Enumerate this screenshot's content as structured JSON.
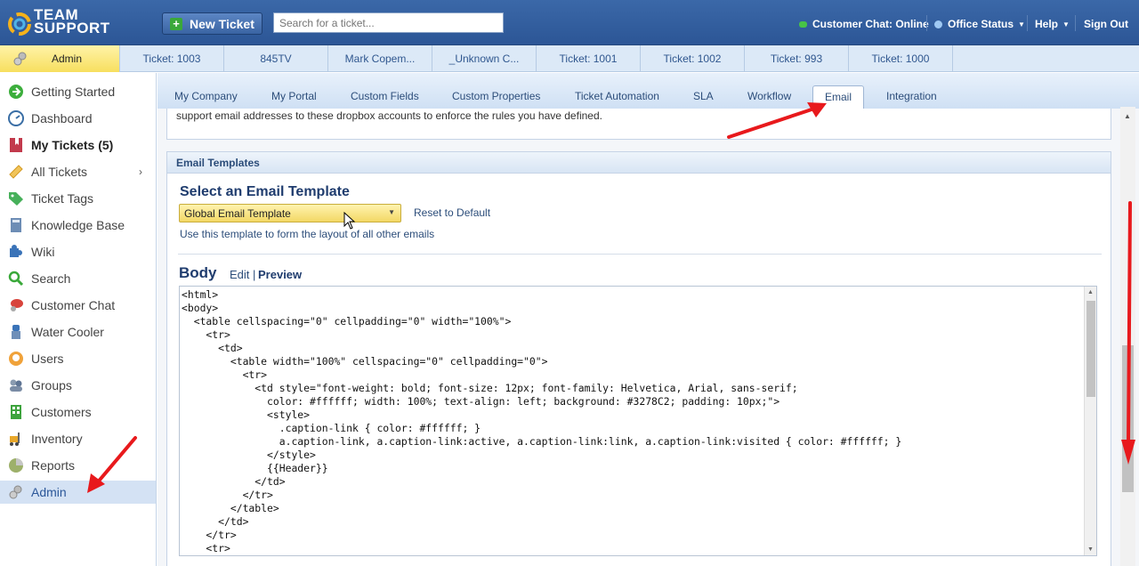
{
  "header": {
    "logo_top": "TEAM",
    "logo_bottom": "SUPPORT",
    "new_ticket_label": "New Ticket",
    "search_placeholder": "Search for a ticket...",
    "customer_chat": "Customer Chat: Online",
    "office_status": "Office Status",
    "help": "Help",
    "sign_out": "Sign Out"
  },
  "ticket_tabs": [
    {
      "label": "Admin"
    },
    {
      "label": "Ticket: 1003"
    },
    {
      "label": "845TV"
    },
    {
      "label": "Mark Copem..."
    },
    {
      "label": "_Unknown C..."
    },
    {
      "label": "Ticket: 1001"
    },
    {
      "label": "Ticket: 1002"
    },
    {
      "label": "Ticket: 993"
    },
    {
      "label": "Ticket: 1000"
    }
  ],
  "sidebar": {
    "items": [
      {
        "label": "Getting Started",
        "icon": "arrow-circle-icon"
      },
      {
        "label": "Dashboard",
        "icon": "gauge-icon"
      },
      {
        "label": "My Tickets (5)",
        "icon": "bookmark-icon"
      },
      {
        "label": "All Tickets",
        "icon": "ticket-icon"
      },
      {
        "label": "Ticket Tags",
        "icon": "tag-icon"
      },
      {
        "label": "Knowledge Base",
        "icon": "book-icon"
      },
      {
        "label": "Wiki",
        "icon": "puzzle-icon"
      },
      {
        "label": "Search",
        "icon": "magnifier-icon"
      },
      {
        "label": "Customer Chat",
        "icon": "chat-icon"
      },
      {
        "label": "Water Cooler",
        "icon": "water-cooler-icon"
      },
      {
        "label": "Users",
        "icon": "user-icon"
      },
      {
        "label": "Groups",
        "icon": "group-icon"
      },
      {
        "label": "Customers",
        "icon": "building-icon"
      },
      {
        "label": "Inventory",
        "icon": "forklift-icon"
      },
      {
        "label": "Reports",
        "icon": "pie-chart-icon"
      },
      {
        "label": "Admin",
        "icon": "gears-icon"
      }
    ]
  },
  "subtabs": [
    {
      "label": "My Company"
    },
    {
      "label": "My Portal"
    },
    {
      "label": "Custom Fields"
    },
    {
      "label": "Custom Properties"
    },
    {
      "label": "Ticket Automation"
    },
    {
      "label": "SLA"
    },
    {
      "label": "Workflow"
    },
    {
      "label": "Email"
    },
    {
      "label": "Integration"
    }
  ],
  "panel1_text": "support email addresses to these dropbox accounts to enforce the rules you have defined.",
  "email_templates": {
    "section_title": "Email Templates",
    "heading": "Select an Email Template",
    "selected_template": "Global Email Template",
    "reset_label": "Reset to Default",
    "hint": "Use this template to form the layout of all other emails",
    "body_heading": "Body",
    "edit_label": "Edit",
    "pipe": "|",
    "preview_label": "Preview",
    "code": "<html>\n<body>\n  <table cellspacing=\"0\" cellpadding=\"0\" width=\"100%\">\n    <tr>\n      <td>\n        <table width=\"100%\" cellspacing=\"0\" cellpadding=\"0\">\n          <tr>\n            <td style=\"font-weight: bold; font-size: 12px; font-family: Helvetica, Arial, sans-serif;\n              color: #ffffff; width: 100%; text-align: left; background: #3278C2; padding: 10px;\">\n              <style>\n                .caption-link { color: #ffffff; }\n                a.caption-link, a.caption-link:active, a.caption-link:link, a.caption-link:visited { color: #ffffff; }\n              </style>\n              {{Header}}\n            </td>\n          </tr>\n        </table>\n      </td>\n    </tr>\n    <tr>"
  },
  "colors": {
    "header_blue": "#2c5696",
    "accent_yellow": "#f7df5f",
    "annotation_red": "#e8191c"
  }
}
